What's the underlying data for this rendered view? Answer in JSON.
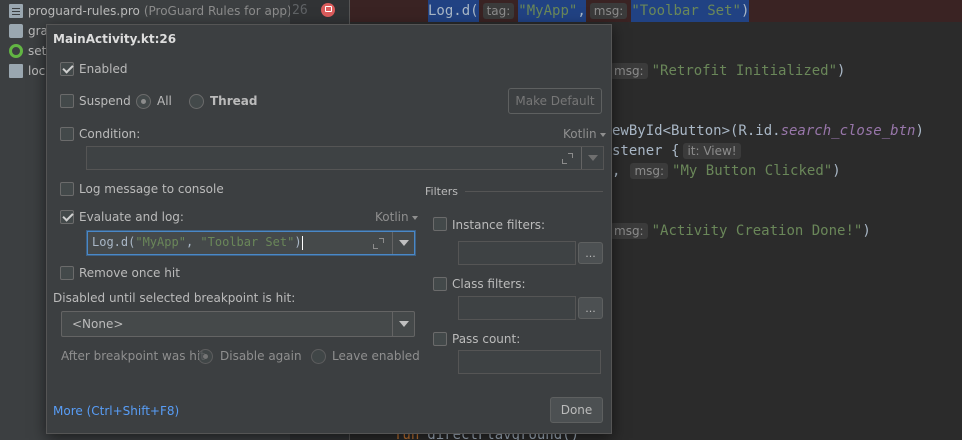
{
  "project": {
    "items": [
      {
        "icon": "file-icon",
        "label": "proguard-rules.pro",
        "suffix": "(ProGuard Rules for app)"
      },
      {
        "icon": "gradle-icon",
        "label": "grac",
        "suffix": ""
      },
      {
        "icon": "settings-icon",
        "label": "setti",
        "suffix": ""
      },
      {
        "icon": "chart-icon",
        "label": "loca",
        "suffix": ""
      }
    ]
  },
  "editor": {
    "line_number": "26",
    "line1": {
      "call": "Log.d(",
      "hint_tag": "tag:",
      "str1": "\"MyApp\"",
      "comma": ",",
      "hint_msg": "msg:",
      "str2": "\"Toolbar Set\"",
      "close": ")"
    },
    "line2": {
      "hint": "msg:",
      "str": "\"Retrofit Initialized\"",
      "close": ")"
    },
    "line3": {
      "pre": "ewById<Button>(R.id.",
      "ital": "search_close_btn",
      "close": ")"
    },
    "line4": {
      "pre": "stener {",
      "hint": "it: View!"
    },
    "line5": {
      "pre": ",",
      "hint": "msg:",
      "str": "\"My Button Clicked\"",
      "close": ")"
    },
    "line6": {
      "hint": "msg:",
      "str": "\"Activity Creation Done!\"",
      "close": ")"
    },
    "line7": {
      "kw": "fun",
      "rest": "directFlavground()"
    }
  },
  "dialog": {
    "title": "MainActivity.kt:26",
    "enabled_label": "Enabled",
    "suspend_label": "Suspend",
    "suspend_all": "All",
    "suspend_thread": "Thread",
    "make_default": "Make Default",
    "condition_label": "Condition:",
    "condition_lang": "Kotlin",
    "condition_value": "",
    "log_message_label": "Log message to console",
    "evaluate_label": "Evaluate and log:",
    "evaluate_lang": "Kotlin",
    "evaluate_code": {
      "call": "Log.d(",
      "str1": "\"MyApp\"",
      "sep": ", ",
      "str2": "\"Toolbar Set\"",
      "close": ")"
    },
    "remove_once_label": "Remove once hit",
    "disabled_until_label": "Disabled until selected breakpoint is hit:",
    "disabled_until_value": "<None>",
    "after_hit_label": "After breakpoint was hit",
    "disable_again": "Disable again",
    "leave_enabled": "Leave enabled",
    "filters_label": "Filters",
    "instance_filters": "Instance filters:",
    "class_filters": "Class filters:",
    "pass_count": "Pass count:",
    "browse_label": "...",
    "more_link": "More (Ctrl+Shift+F8)",
    "done": "Done"
  }
}
